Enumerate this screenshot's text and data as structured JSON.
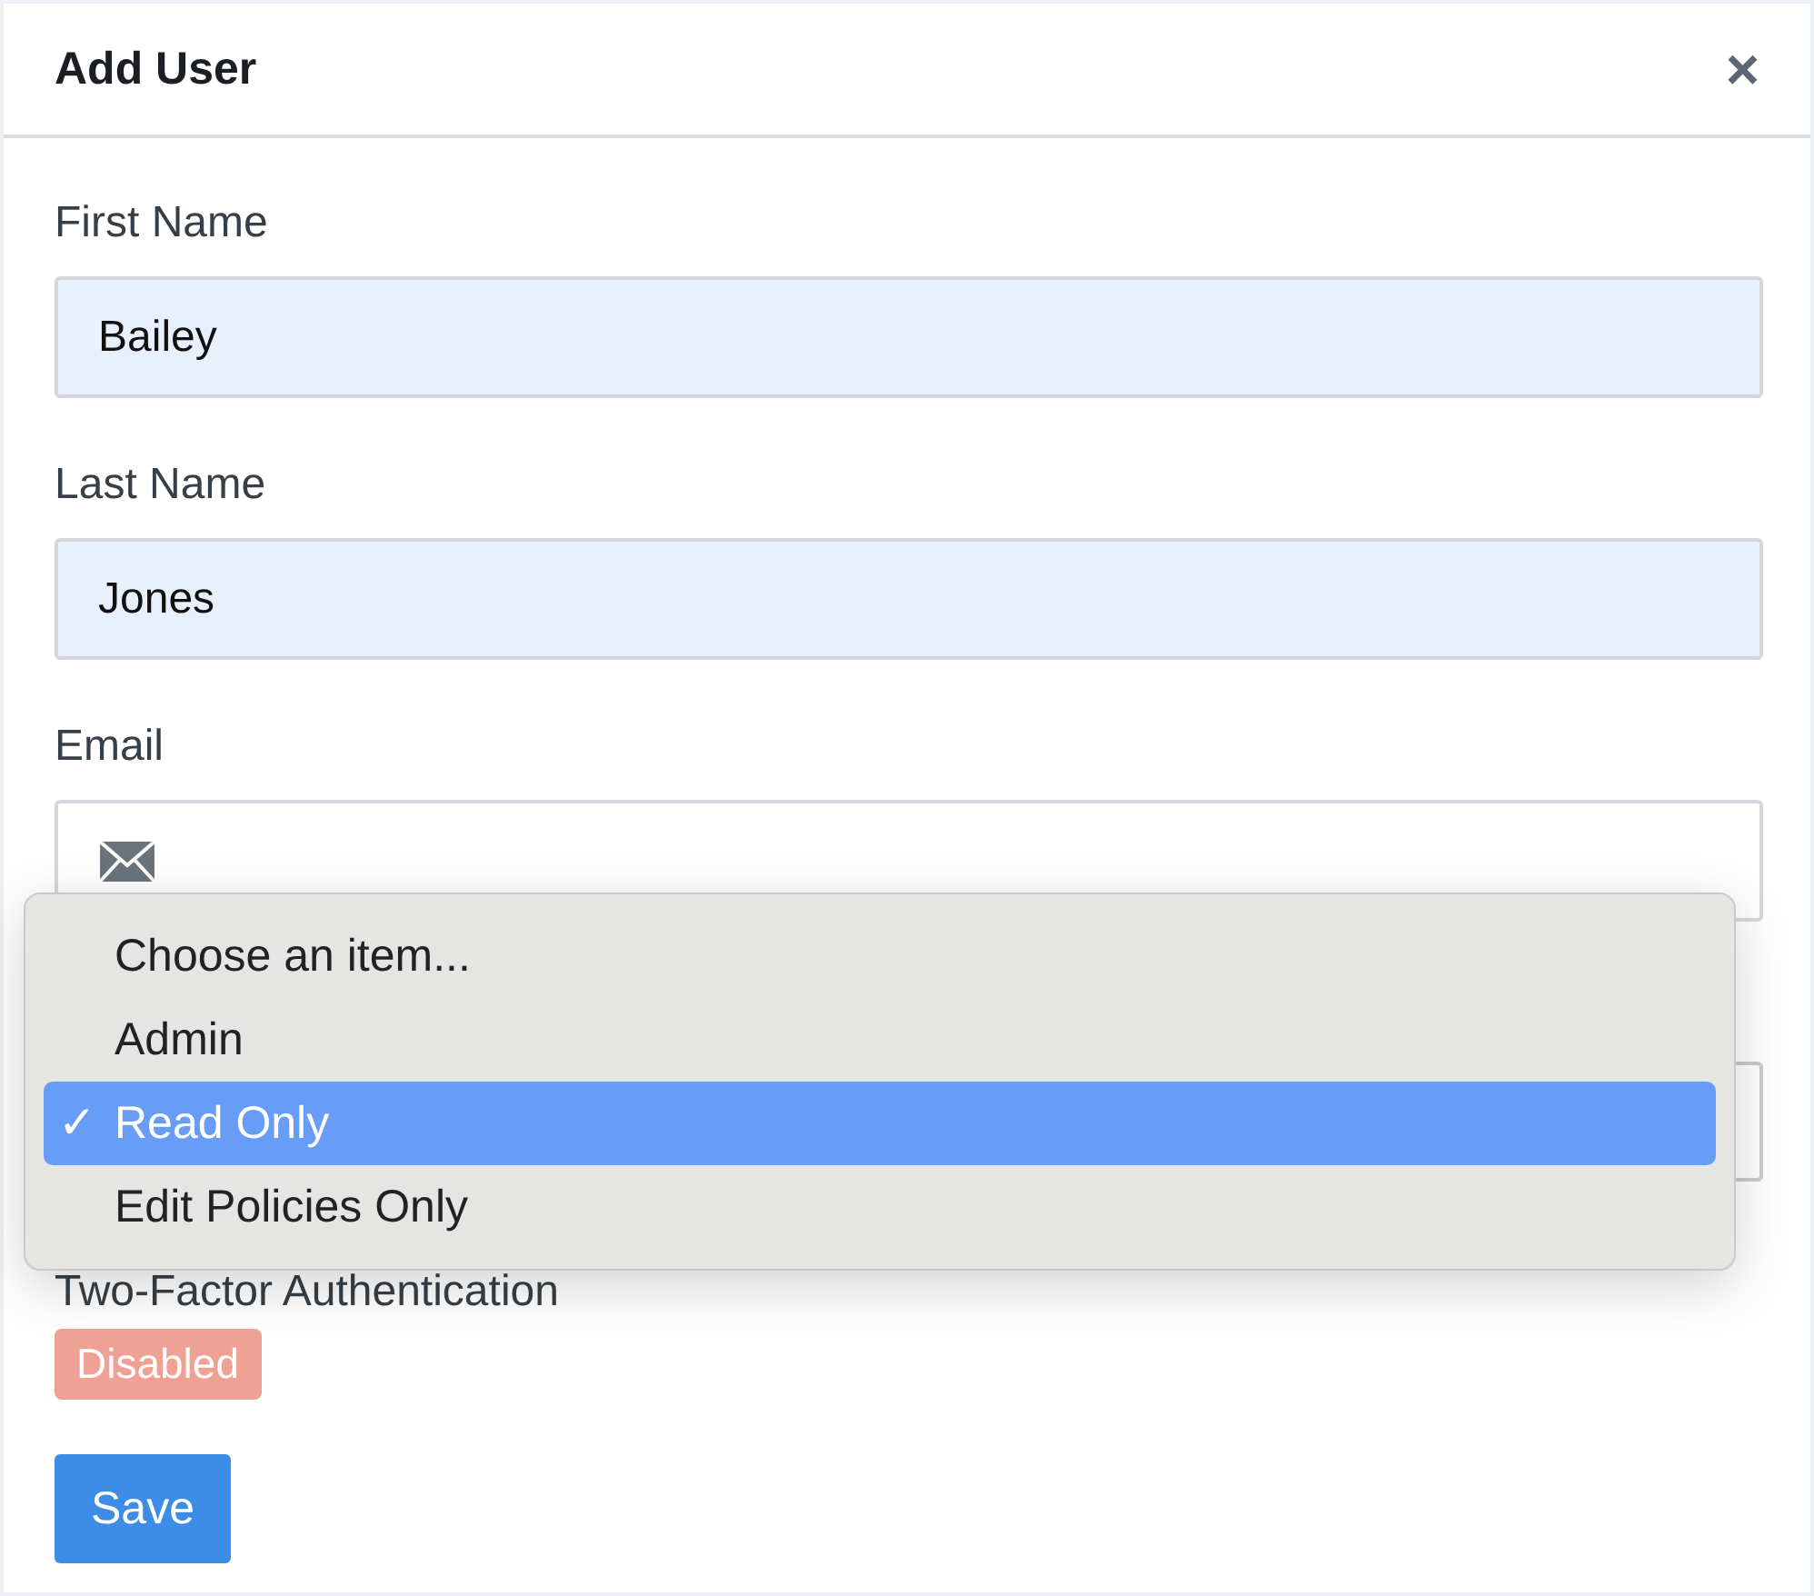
{
  "dialog": {
    "title": "Add User",
    "close": "×"
  },
  "fields": [
    {
      "label": "First Name",
      "value": "Bailey",
      "kind": "text",
      "autofilled": true
    },
    {
      "label": "Last Name",
      "value": "Jones",
      "kind": "text",
      "autofilled": true
    },
    {
      "label": "Email",
      "kind": "email",
      "autofilled": false
    },
    {
      "kind": "select"
    }
  ],
  "dropdown": {
    "options": [
      {
        "label": "Choose an item...",
        "selected": false
      },
      {
        "label": "Admin",
        "selected": false
      },
      {
        "label": "Read Only",
        "selected": true
      },
      {
        "label": "Edit Policies Only",
        "selected": false
      }
    ],
    "check": "✓"
  },
  "two_factor": {
    "label": "Two-Factor Authentication",
    "status": "Disabled",
    "enabled": false
  },
  "save_button": "Save"
}
